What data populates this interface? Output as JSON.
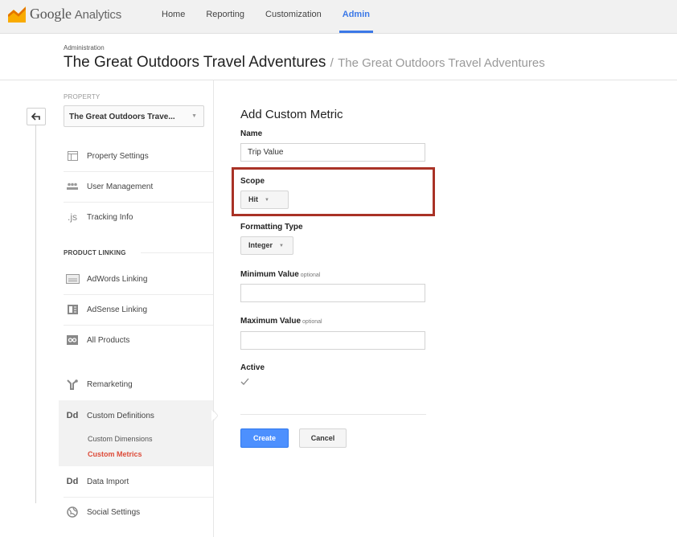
{
  "app": {
    "logo_word": "Google",
    "logo_product": "Analytics",
    "brand_colors": [
      "#f9ab00",
      "#e37400"
    ]
  },
  "nav": {
    "items": [
      {
        "label": "Home",
        "active": false
      },
      {
        "label": "Reporting",
        "active": false
      },
      {
        "label": "Customization",
        "active": false
      },
      {
        "label": "Admin",
        "active": true
      }
    ],
    "active_color": "#3b78e7"
  },
  "header": {
    "breadcrumb": "Administration",
    "title": "The Great Outdoors Travel Adventures",
    "separator": "/",
    "subtitle": "The Great Outdoors Travel Adventures"
  },
  "sidebar": {
    "back_icon": "back-arrow-icon",
    "property_label": "PROPERTY",
    "property_value": "The Great Outdoors Trave...",
    "items": [
      {
        "label": "Property Settings",
        "icon": "property-settings-icon"
      },
      {
        "label": "User Management",
        "icon": "users-icon"
      },
      {
        "label": "Tracking Info",
        "icon": "js-icon",
        "icon_text": ".js"
      },
      {
        "label": "AdWords Linking",
        "icon": "adwords-icon"
      },
      {
        "label": "AdSense Linking",
        "icon": "adsense-icon"
      },
      {
        "label": "All Products",
        "icon": "all-products-icon"
      },
      {
        "label": "Remarketing",
        "icon": "remarketing-icon"
      },
      {
        "label": "Custom Definitions",
        "icon": "dd-icon",
        "icon_text": "Dd"
      },
      {
        "label": "Data Import",
        "icon": "dd-icon",
        "icon_text": "Dd"
      },
      {
        "label": "Social Settings",
        "icon": "social-icon"
      }
    ],
    "product_linking_label": "PRODUCT LINKING",
    "sub_items": [
      {
        "label": "Custom Dimensions",
        "active": false
      },
      {
        "label": "Custom Metrics",
        "active": true
      }
    ],
    "active_sub_color": "#dd4b39"
  },
  "form": {
    "title": "Add Custom Metric",
    "name_label": "Name",
    "name_value": "Trip Value",
    "scope_label": "Scope",
    "scope_value": "Hit",
    "formatting_label": "Formatting Type",
    "formatting_value": "Integer",
    "min_label": "Minimum Value",
    "min_optional": "optional",
    "min_value": "",
    "max_label": "Maximum Value",
    "max_optional": "optional",
    "max_value": "",
    "active_label": "Active",
    "active_checked": true,
    "create_label": "Create",
    "cancel_label": "Cancel",
    "create_color": "#4d90fe",
    "highlight_color": "#a93226"
  }
}
